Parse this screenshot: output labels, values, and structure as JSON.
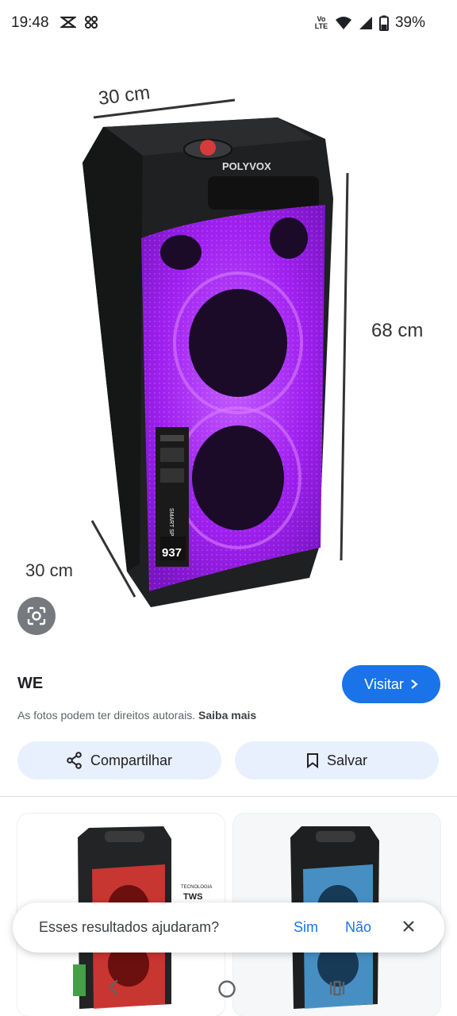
{
  "status_bar": {
    "time": "19:48",
    "network_label": "Vo LTE",
    "battery_percent": "39%",
    "icons": [
      "capcut-icon",
      "app-grid-icon",
      "wifi-icon",
      "signal-icon",
      "battery-icon"
    ]
  },
  "product_image": {
    "brand": "POLYVOX",
    "width_label": "30 cm",
    "height_label": "68 cm",
    "depth_label": "30 cm",
    "light_color": "#a020f0",
    "box_labels": [
      "SMART SPEAKER",
      "937"
    ]
  },
  "result": {
    "source_name": "WE",
    "visit_label": "Visitar",
    "copyright_text": "As fotos podem ter direitos autorais.",
    "learn_more_label": "Saiba mais"
  },
  "actions": {
    "share_label": "Compartilhar",
    "save_label": "Salvar"
  },
  "related": {
    "thumb1_label": "TECNOLOGIA",
    "thumb1_badge": "TWS",
    "thumb1_light": "#e53935",
    "thumb2_light": "#4fa3e0"
  },
  "feedback": {
    "question": "Esses resultados ajudaram?",
    "yes_label": "Sim",
    "no_label": "Não"
  },
  "colors": {
    "accent": "#1a73e8",
    "chip_background": "#e8f0fe"
  }
}
